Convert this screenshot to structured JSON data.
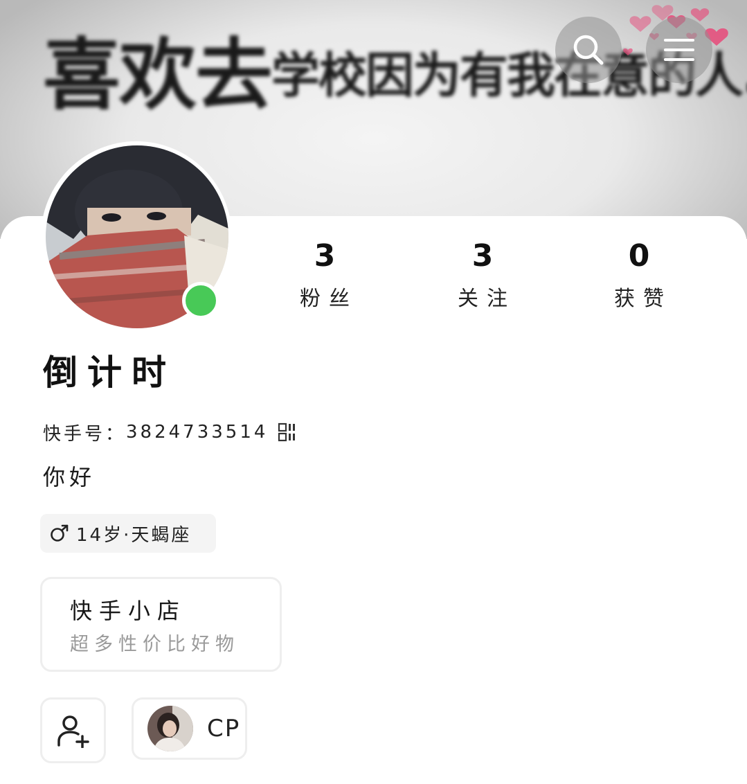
{
  "banner": {
    "text_big": "喜欢去",
    "text_small": "学校因为有我在意的人."
  },
  "header": {
    "search_icon": "search-icon",
    "menu_icon": "hamburger-menu-icon"
  },
  "profile": {
    "online": true,
    "stats": [
      {
        "value": "3",
        "label": "粉丝"
      },
      {
        "value": "3",
        "label": "关注"
      },
      {
        "value": "0",
        "label": "获赞"
      }
    ],
    "username": "倒计时",
    "kuaishou_id_label": "快手号：",
    "kuaishou_id": "3824733514",
    "bio": "你好",
    "tag": "14岁·天蝎座"
  },
  "shop": {
    "title": "快手小店",
    "subtitle": "超多性价比好物"
  },
  "actions": {
    "cp_label": "CP"
  },
  "colors": {
    "online": "#48c957",
    "hearts": "#e84a7a"
  }
}
